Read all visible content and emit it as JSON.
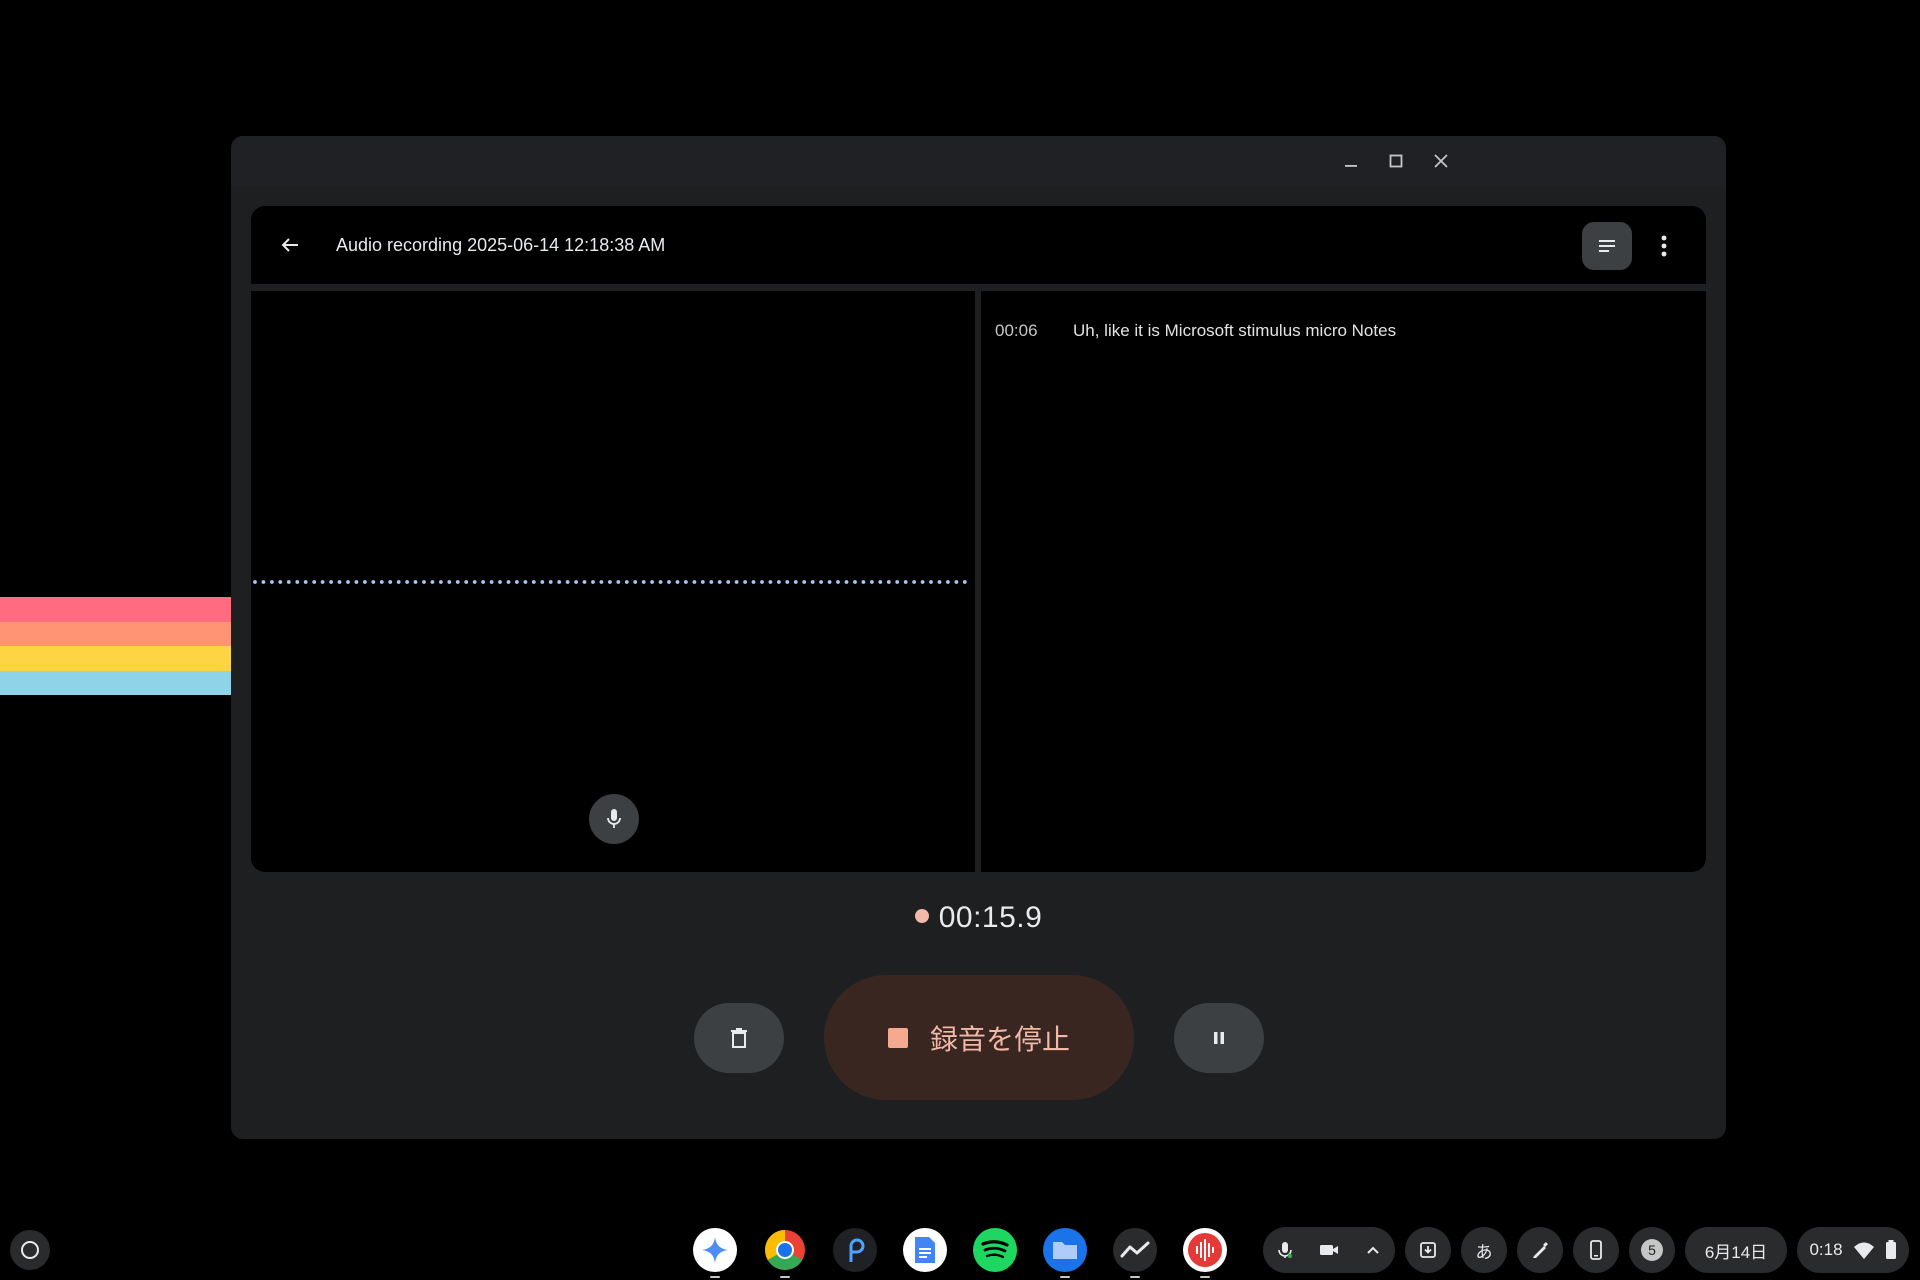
{
  "window": {
    "title": "Audio recording 2025-06-14 12:18:38 AM"
  },
  "transcript": {
    "rows": [
      {
        "time": "00:06",
        "text": "Uh, like it is Microsoft stimulus micro Notes"
      }
    ]
  },
  "recording": {
    "elapsed": "00:15.9",
    "stop_label": "録音を停止"
  },
  "shelf": {
    "apps": [
      "gemini-icon",
      "chrome-icon",
      "pen-app-icon",
      "docs-icon",
      "spotify-icon",
      "files-icon",
      "activity-icon",
      "recorder-icon"
    ],
    "ime_label": "あ",
    "notification_count": "5",
    "date": "6月14日",
    "time": "0:18"
  },
  "colors": {
    "accent": "#f2b8a8",
    "stop_bg": "#3a2620",
    "waveform": "#a8c7fa"
  }
}
